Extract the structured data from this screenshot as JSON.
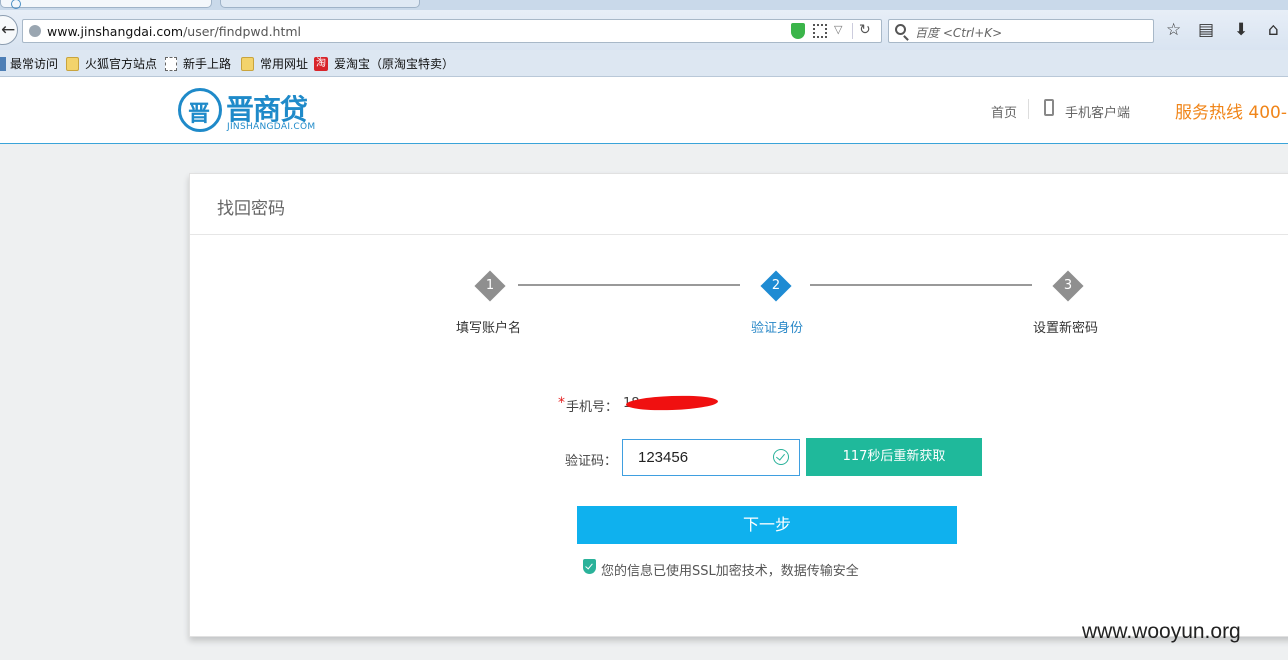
{
  "browser": {
    "tabs": [
      {
        "title": "",
        "active": true
      },
      {
        "title": "",
        "active": false
      }
    ],
    "url_domain": "www.jinshangdai.com",
    "url_path": "/user/findpwd.html",
    "search_placeholder": "百度 <Ctrl+K>",
    "bookmarks": [
      "最常访问",
      "火狐官方站点",
      "新手上路",
      "常用网址",
      "爱淘宝（原淘宝特卖）"
    ],
    "toolbar_icons": [
      "star-icon",
      "reading-list-icon",
      "download-icon",
      "home-icon"
    ]
  },
  "site": {
    "logo_name": "晋商贷",
    "logo_sub": "JINSHANGDAI.COM",
    "nav_home": "首页",
    "nav_mobile": "手机客户端",
    "hotline": "服务热线 400-"
  },
  "page": {
    "title": "找回密码",
    "steps": [
      {
        "num": "1",
        "label": "填写账户名",
        "active": false
      },
      {
        "num": "2",
        "label": "验证身份",
        "active": true
      },
      {
        "num": "3",
        "label": "设置新密码",
        "active": false
      }
    ],
    "required_mark": "*",
    "phone_label": "手机号：",
    "phone_value": "18",
    "code_label": "验证码：",
    "code_value": "123456",
    "resend_label": "117秒后重新获取",
    "next_label": "下一步",
    "ssl_note": "您的信息已使用SSL加密技术，数据传输安全"
  },
  "watermark": "www.wooyun.org",
  "colors": {
    "brand_blue": "#1f8ac9",
    "hotline_orange": "#f08519",
    "resend_green": "#1fb99b",
    "next_blue": "#0fb1ee",
    "active_step": "#1e8bd3"
  }
}
